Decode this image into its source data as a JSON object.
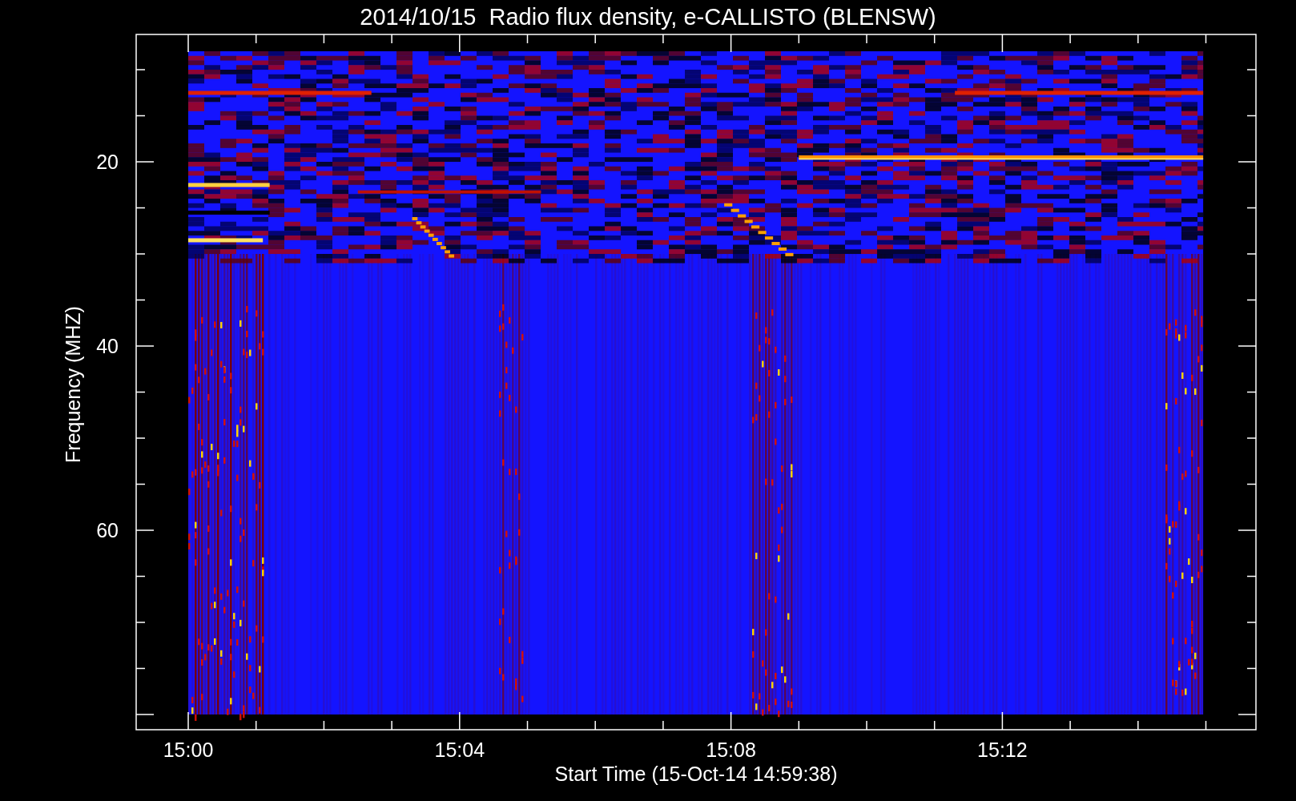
{
  "title": "2014/10/15  Radio flux density, e-CALLISTO (BLENSW)",
  "plot": {
    "xlabel": "Start Time (15-Oct-14 14:59:38)",
    "ylabel": "Frequency (MHZ)",
    "xticks": [
      "15:00",
      "15:04",
      "15:08",
      "15:12"
    ],
    "yticks": [
      "20",
      "40",
      "60"
    ]
  }
}
